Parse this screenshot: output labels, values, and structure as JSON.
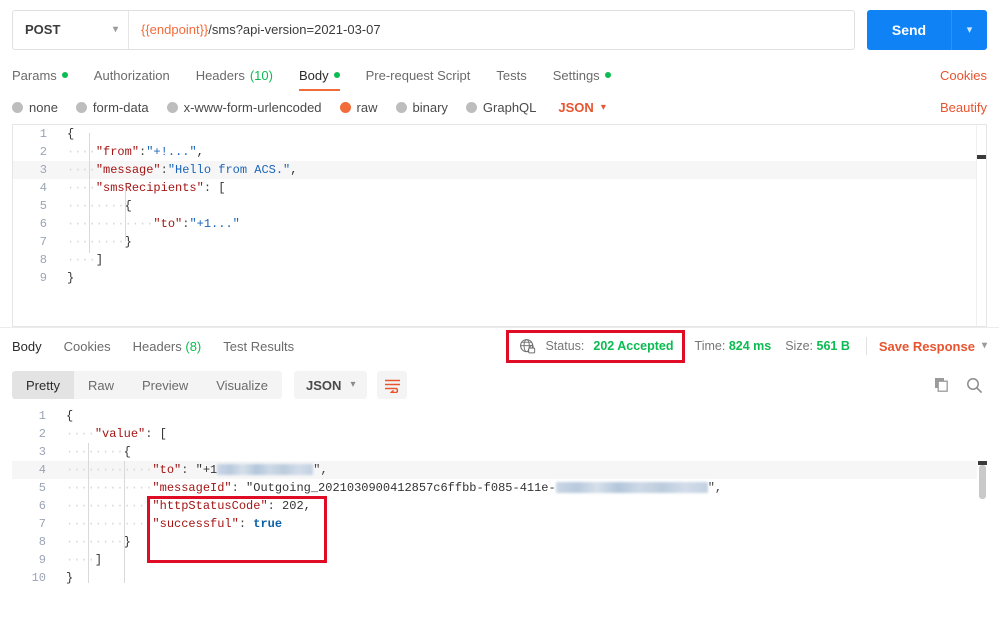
{
  "request": {
    "method": "POST",
    "method_caret": "chevron-down",
    "url_variable": "{{endpoint}}",
    "url_rest": "/sms?api-version=2021-03-07",
    "send_label": "Send",
    "tabs": [
      {
        "label": "Params",
        "dot": true,
        "active": false
      },
      {
        "label": "Authorization",
        "dot": false,
        "active": false
      },
      {
        "label": "Headers",
        "count": "(10)",
        "active": false
      },
      {
        "label": "Body",
        "dot": true,
        "active": true
      },
      {
        "label": "Pre-request Script",
        "dot": false,
        "active": false
      },
      {
        "label": "Tests",
        "dot": false,
        "active": false
      },
      {
        "label": "Settings",
        "dot": true,
        "active": false
      }
    ],
    "cookies_label": "Cookies",
    "beautify_label": "Beautify",
    "body_types": [
      {
        "label": "none",
        "selected": false
      },
      {
        "label": "form-data",
        "selected": false
      },
      {
        "label": "x-www-form-urlencoded",
        "selected": false
      },
      {
        "label": "raw",
        "selected": true
      },
      {
        "label": "binary",
        "selected": false
      },
      {
        "label": "GraphQL",
        "selected": false
      }
    ],
    "raw_format": "JSON",
    "body_lines": [
      {
        "n": "1",
        "text": "{"
      },
      {
        "n": "2",
        "text": "    \"from\":\"+!...\","
      },
      {
        "n": "3",
        "text": "    \"message\":\"Hello from ACS.\",",
        "highlight": true
      },
      {
        "n": "4",
        "text": "    \"smsRecipients\": ["
      },
      {
        "n": "5",
        "text": "        {"
      },
      {
        "n": "6",
        "text": "            \"to\":\"+1...\""
      },
      {
        "n": "7",
        "text": "        }"
      },
      {
        "n": "8",
        "text": "    ]"
      },
      {
        "n": "9",
        "text": "}"
      }
    ]
  },
  "response": {
    "tabs": [
      {
        "label": "Body",
        "active": true
      },
      {
        "label": "Cookies",
        "active": false
      },
      {
        "label": "Headers",
        "count": "(8)",
        "active": false
      },
      {
        "label": "Test Results",
        "active": false
      }
    ],
    "status_label": "Status:",
    "status_value": "202 Accepted",
    "time_label": "Time:",
    "time_value": "824 ms",
    "size_label": "Size:",
    "size_value": "561 B",
    "save_response_label": "Save Response",
    "view_modes": [
      {
        "label": "Pretty",
        "active": true
      },
      {
        "label": "Raw",
        "active": false
      },
      {
        "label": "Preview",
        "active": false
      },
      {
        "label": "Visualize",
        "active": false
      }
    ],
    "format": "JSON",
    "body_lines": [
      {
        "n": "1",
        "text": "{"
      },
      {
        "n": "2",
        "text": "    \"value\": ["
      },
      {
        "n": "3",
        "text": "        {"
      },
      {
        "n": "4",
        "text": "            \"to\": \"+1",
        "redacted": true,
        "suffix": "\",",
        "highlight": true
      },
      {
        "n": "5",
        "text": "            \"messageId\": \"Outgoing_2021030900412857c6ffbb-f085-411e-",
        "redacted": true,
        "suffix": "\","
      },
      {
        "n": "6",
        "text": "            \"httpStatusCode\": 202,"
      },
      {
        "n": "7",
        "text": "            \"successful\": true"
      },
      {
        "n": "8",
        "text": "        }"
      },
      {
        "n": "9",
        "text": "    ]"
      },
      {
        "n": "10",
        "text": "}"
      }
    ]
  },
  "annotations": {
    "status_box_note": "red-highlight-around-status",
    "body_box_note": "red-highlight-around-httpStatusCode-and-successful"
  },
  "colors": {
    "send_blue": "#0f82f5",
    "accent_orange": "#e8542f",
    "success_green": "#0cbb52",
    "highlight_red": "#e00b24"
  },
  "icons": {
    "copy": "copy-icon",
    "search": "search-icon",
    "wrap": "word-wrap-icon",
    "globe_lock": "globe-lock-icon"
  }
}
